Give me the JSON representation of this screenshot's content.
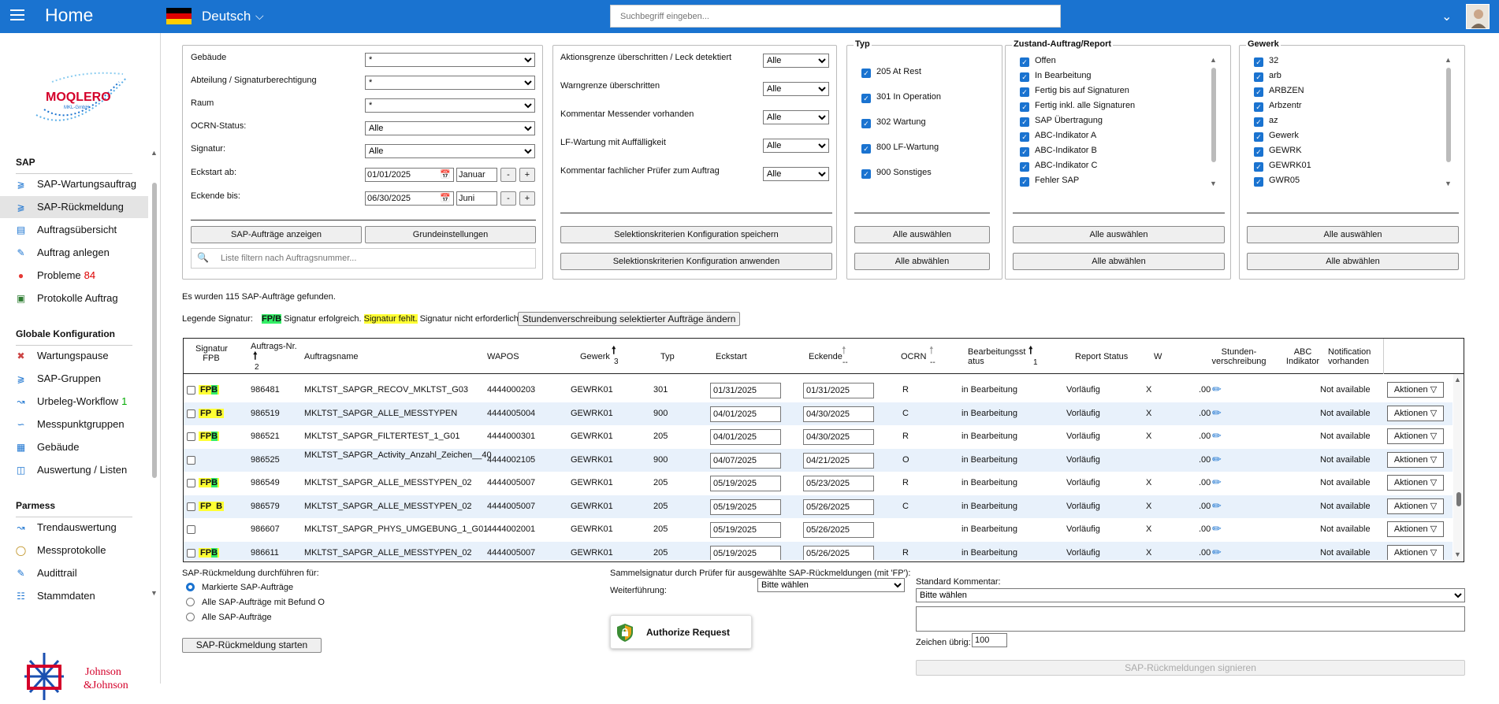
{
  "header": {
    "title": "Home",
    "language": "Deutsch",
    "search_placeholder": "Suchbegriff eingeben..."
  },
  "sidebar": {
    "sections": [
      {
        "title": "SAP",
        "items": [
          {
            "label": "SAP-Wartungsauftrag",
            "icon": "tag-icon"
          },
          {
            "label": "SAP-Rückmeldung",
            "icon": "tag-icon",
            "active": true
          },
          {
            "label": "Auftragsübersicht",
            "icon": "document-icon"
          },
          {
            "label": "Auftrag anlegen",
            "icon": "edit-document-icon"
          },
          {
            "label": "Probleme",
            "count": "84",
            "icon": "alert-icon"
          },
          {
            "label": "Protokolle Auftrag",
            "icon": "checkbox-icon"
          }
        ]
      },
      {
        "title": "Globale Konfiguration",
        "items": [
          {
            "label": "Wartungspause",
            "icon": "tools-icon"
          },
          {
            "label": "SAP-Gruppen",
            "icon": "tag-icon"
          },
          {
            "label": "Urbeleg-Workflow",
            "count": "1",
            "icon": "workflow-icon"
          },
          {
            "label": "Messpunktgruppen",
            "icon": "network-icon"
          },
          {
            "label": "Gebäude",
            "icon": "building-icon"
          },
          {
            "label": "Auswertung / Listen",
            "icon": "clipboard-icon"
          }
        ]
      },
      {
        "title": "Parmess",
        "items": [
          {
            "label": "Trendauswertung",
            "icon": "trend-chart-icon"
          },
          {
            "label": "Messprotokolle",
            "icon": "gauge-icon"
          },
          {
            "label": "Audittrail",
            "icon": "audit-icon"
          },
          {
            "label": "Stammdaten",
            "icon": "hierarchy-icon"
          }
        ]
      }
    ],
    "logo_text": "MOQLERO",
    "logo_sub": "MKL-GmbH",
    "partner_logo": "Johnson & Johnson"
  },
  "filters": {
    "gebaeude": {
      "label": "Gebäude",
      "value": "*"
    },
    "abteilung": {
      "label": "Abteilung / Signaturberechtigung",
      "value": "*"
    },
    "raum": {
      "label": "Raum",
      "value": "*"
    },
    "ocrn": {
      "label": "OCRN-Status:",
      "value": "Alle"
    },
    "signatur": {
      "label": "Signatur:",
      "value": "Alle"
    },
    "eckstart": {
      "label": "Eckstart ab:",
      "date": "01/01/2025",
      "month": "Januar"
    },
    "eckende": {
      "label": "Eckende bis:",
      "date": "06/30/2025",
      "month": "Juni"
    },
    "minus": "-",
    "plus": "+",
    "show_button": "SAP-Aufträge  anzeigen",
    "reset_button": "Grundeinstellungen",
    "list_filter_placeholder": "Liste filtern nach Auftragsnummer..."
  },
  "criteria": {
    "items": [
      {
        "label": "Aktionsgrenze überschritten / Leck detektiert",
        "value": "Alle"
      },
      {
        "label": "Warngrenze überschritten",
        "value": "Alle"
      },
      {
        "label": "Kommentar Messender vorhanden",
        "value": "Alle"
      },
      {
        "label": "LF-Wartung mit Auffälligkeit",
        "value": "Alle"
      },
      {
        "label": "Kommentar fachlicher Prüfer zum Auftrag",
        "value": "Alle"
      }
    ],
    "save_button": "Selektionskriterien Konfiguration speichern",
    "apply_button": "Selektionskriterien Konfiguration anwenden"
  },
  "typ": {
    "title": "Typ",
    "items": [
      "205 At Rest",
      "301 In Operation",
      "302 Wartung",
      "800 LF-Wartung",
      "900 Sonstiges"
    ],
    "select_all": "Alle auswählen",
    "deselect_all": "Alle abwählen"
  },
  "zustand": {
    "title": "Zustand-Auftrag/Report",
    "items": [
      "Offen",
      "In Bearbeitung",
      "Fertig bis auf Signaturen",
      "Fertig inkl. alle Signaturen",
      "SAP Übertragung",
      "ABC-Indikator A",
      "ABC-Indikator B",
      "ABC-Indikator C",
      "Fehler SAP"
    ],
    "select_all": "Alle auswählen",
    "deselect_all": "Alle abwählen"
  },
  "gewerk": {
    "title": "Gewerk",
    "items": [
      "32",
      "arb",
      "ARBZEN",
      "Arbzentr",
      "az",
      "Gewerk",
      "GEWRK",
      "GEWRK01",
      "GWR05"
    ],
    "select_all": "Alle auswählen",
    "deselect_all": "Alle abwählen"
  },
  "results": {
    "found_text": "Es wurden 115 SAP-Aufträge gefunden.",
    "legend_label": "Legende Signatur:",
    "legend_fp": "FP",
    "legend_b": "B",
    "legend_ok": "Signatur erfolgreich.",
    "legend_missing": "Signatur fehlt.",
    "legend_not_required": "Signatur nicht erforderlich.",
    "hours_button": "Stundenverschreibung selektierter Aufträge ändern"
  },
  "table": {
    "headers": {
      "signatur": "Signatur FPB",
      "nr": "Auftrags-Nr.",
      "nr_sort": "2",
      "name": "Auftragsname",
      "wapos": "WAPOS",
      "gewerk": "Gewerk",
      "gewerk_sort": "3",
      "typ": "Typ",
      "eckstart": "Eckstart",
      "eckende": "Eckende",
      "eckende_sort": "--",
      "ocrn": "OCRN",
      "ocrn_sort": "--",
      "bearb": "Bearbeitungsst atus",
      "bearb_sort": "1",
      "report": "Report Status",
      "w": "W",
      "stunden": "Stunden-verschreibung",
      "abc": "ABC Indikator",
      "notif": "Notification vorhanden"
    },
    "rows": [
      {
        "sig": "FPB_green",
        "nr": "986481",
        "name": "MKLTST_SAPGR_RECOV_MKLTST_G03",
        "wapos": "4444000203",
        "gewerk": "GEWRK01",
        "typ": "301",
        "start": "01/31/2025",
        "end": "01/31/2025",
        "ocrn": "R",
        "bearb": "in Bearbeitung",
        "report": "Vorläufig",
        "w": "X",
        "hours": ".00",
        "notif": "Not available",
        "action": "Aktionen ▽"
      },
      {
        "sig": "FP_B_yellow",
        "nr": "986519",
        "name": "MKLTST_SAPGR_ALLE_MESSTYPEN",
        "wapos": "4444005004",
        "gewerk": "GEWRK01",
        "typ": "900",
        "start": "04/01/2025",
        "end": "04/30/2025",
        "ocrn": "C",
        "bearb": "in Bearbeitung",
        "report": "Vorläufig",
        "w": "X",
        "hours": ".00",
        "notif": "Not available",
        "action": "Aktionen ▽"
      },
      {
        "sig": "FPB_green",
        "nr": "986521",
        "name": "MKLTST_SAPGR_FILTERTEST_1_G01",
        "wapos": "4444000301",
        "gewerk": "GEWRK01",
        "typ": "205",
        "start": "04/01/2025",
        "end": "04/30/2025",
        "ocrn": "R",
        "bearb": "in Bearbeitung",
        "report": "Vorläufig",
        "w": "X",
        "hours": ".00",
        "notif": "Not available",
        "action": "Aktionen ▽"
      },
      {
        "sig": "",
        "nr": "986525",
        "name": "MKLTST_SAPGR_Activity_Anzahl_Zeichen__40",
        "wapos": "4444002105",
        "gewerk": "GEWRK01",
        "typ": "900",
        "start": "04/07/2025",
        "end": "04/21/2025",
        "ocrn": "O",
        "bearb": "in Bearbeitung",
        "report": "Vorläufig",
        "w": "",
        "hours": ".00",
        "notif": "Not available",
        "action": "Aktionen ▽"
      },
      {
        "sig": "FPB_green",
        "nr": "986549",
        "name": "MKLTST_SAPGR_ALLE_MESSTYPEN_02",
        "wapos": "4444005007",
        "gewerk": "GEWRK01",
        "typ": "205",
        "start": "05/19/2025",
        "end": "05/23/2025",
        "ocrn": "R",
        "bearb": "in Bearbeitung",
        "report": "Vorläufig",
        "w": "X",
        "hours": ".00",
        "notif": "Not available",
        "action": "Aktionen ▽"
      },
      {
        "sig": "FP_B_yellow",
        "nr": "986579",
        "name": "MKLTST_SAPGR_ALLE_MESSTYPEN_02",
        "wapos": "4444005007",
        "gewerk": "GEWRK01",
        "typ": "205",
        "start": "05/19/2025",
        "end": "05/26/2025",
        "ocrn": "C",
        "bearb": "in Bearbeitung",
        "report": "Vorläufig",
        "w": "X",
        "hours": ".00",
        "notif": "Not available",
        "action": "Aktionen ▽"
      },
      {
        "sig": "",
        "nr": "986607",
        "name": "MKLTST_SAPGR_PHYS_UMGEBUNG_1_G01",
        "wapos": "4444002001",
        "gewerk": "GEWRK01",
        "typ": "205",
        "start": "05/19/2025",
        "end": "05/26/2025",
        "ocrn": "",
        "bearb": "in Bearbeitung",
        "report": "Vorläufig",
        "w": "X",
        "hours": ".00",
        "notif": "Not available",
        "action": "Aktionen ▽"
      },
      {
        "sig": "FPB_green",
        "nr": "986611",
        "name": "MKLTST_SAPGR_ALLE_MESSTYPEN_02",
        "wapos": "4444005007",
        "gewerk": "GEWRK01",
        "typ": "205",
        "start": "05/19/2025",
        "end": "05/26/2025",
        "ocrn": "R",
        "bearb": "in Bearbeitung",
        "report": "Vorläufig",
        "w": "X",
        "hours": ".00",
        "notif": "Not available",
        "action": "Aktionen ▽"
      }
    ]
  },
  "footer": {
    "execute_label": "SAP-Rückmeldung durchführen für:",
    "radio_marked": "Markierte SAP-Aufträge",
    "radio_befund": "Alle SAP-Aufträge mit Befund O",
    "radio_all": "Alle SAP-Aufträge",
    "start_button": "SAP-Rückmeldung starten",
    "sammel_label": "Sammelsignatur durch Prüfer für ausgewählte SAP-Rückmeldungen (mit 'FP'):",
    "weiter_label": "Weiterführung:",
    "weiter_value": "Bitte wählen",
    "authorize_button": "Authorize Request",
    "kommentar_label": "Standard Kommentar:",
    "kommentar_value": "Bitte wählen",
    "zeichen_label": "Zeichen übrig:",
    "zeichen_value": "100",
    "sign_button": "SAP-Rückmeldungen signieren"
  }
}
